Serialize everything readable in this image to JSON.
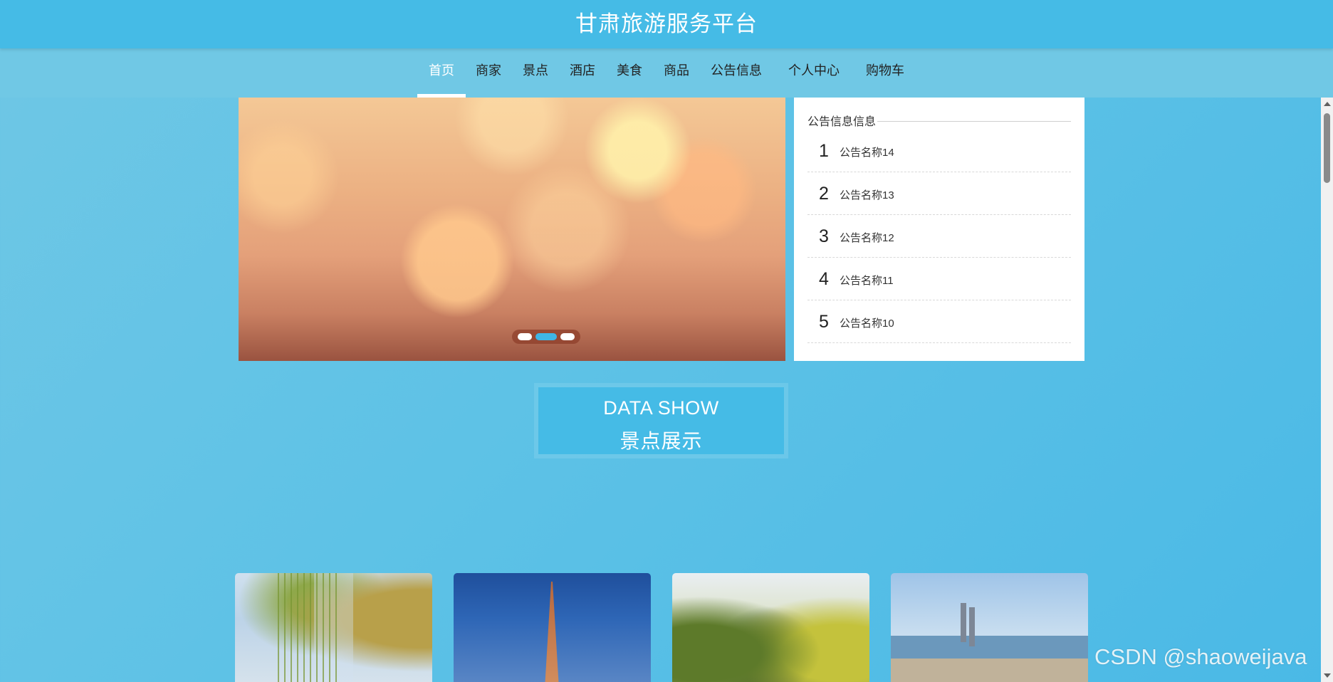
{
  "header": {
    "site_title": "甘肃旅游服务平台"
  },
  "nav": {
    "items": [
      {
        "label": "首页",
        "active": true
      },
      {
        "label": "商家"
      },
      {
        "label": "景点"
      },
      {
        "label": "酒店"
      },
      {
        "label": "美食"
      },
      {
        "label": "商品"
      },
      {
        "label": "公告信息"
      },
      {
        "label": "个人中心"
      },
      {
        "label": "购物车"
      }
    ]
  },
  "banner": {
    "slide_count": 3,
    "active_slide": 2
  },
  "notice": {
    "title": "公告信息信息",
    "items": [
      {
        "num": "1",
        "name": "公告名称14"
      },
      {
        "num": "2",
        "name": "公告名称13"
      },
      {
        "num": "3",
        "name": "公告名称12"
      },
      {
        "num": "4",
        "name": "公告名称11"
      },
      {
        "num": "5",
        "name": "公告名称10"
      }
    ]
  },
  "section": {
    "title_en": "DATA SHOW",
    "title_cn": "景点展示"
  },
  "watermark": "CSDN @shaoweijava",
  "colors": {
    "primary": "#45bbe6",
    "nav_bg": "#70c8e5",
    "panel_bg": "#ffffff"
  }
}
